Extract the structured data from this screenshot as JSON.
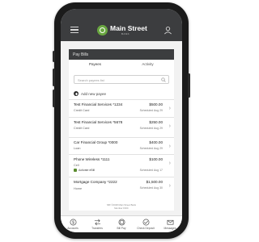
{
  "app": {
    "brand_name": "Main Street",
    "brand_sub": "BANK"
  },
  "header": {
    "title": "Pay Bills"
  },
  "tabs": [
    {
      "label": "Payees",
      "active": true
    },
    {
      "label": "Activity",
      "active": false
    }
  ],
  "search": {
    "placeholder": "Search payees list"
  },
  "add_payee": {
    "label": "Add new payee"
  },
  "payees": [
    {
      "name": "Test Financial Services *1234",
      "type": "Credit Card",
      "amount": "$500.00",
      "scheduled": "Scheduled Aug 29"
    },
    {
      "name": "Test Financial Services *5678",
      "type": "Credit Card",
      "amount": "$250.00",
      "scheduled": "Scheduled Aug 29"
    },
    {
      "name": "Car Financial Group *0000",
      "type": "Loan",
      "amount": "$400.00",
      "scheduled": "Scheduled Aug 29"
    },
    {
      "name": "Phone Wireless *1111",
      "type": "Cell",
      "activate": "Activate eBill",
      "amount": "$100.00",
      "scheduled": "Scheduled Aug 17"
    },
    {
      "name": "Mortgage Company *2222",
      "type": "Home",
      "amount": "$1,500.00",
      "scheduled": "Scheduled Aug 30"
    }
  ],
  "footer": {
    "line1": "NB! ©2018 Main Street Bank",
    "line2": "Member FDIC"
  },
  "bottom_nav": [
    {
      "label": "Accounts",
      "icon": "dollar-circle-icon"
    },
    {
      "label": "Transfers",
      "icon": "transfer-arrows-icon"
    },
    {
      "label": "Bill Pay",
      "icon": "bill-pay-icon"
    },
    {
      "label": "Check Deposit",
      "icon": "camera-check-icon"
    },
    {
      "label": "Messages",
      "icon": "envelope-icon"
    }
  ],
  "colors": {
    "appbar": "#3c3d3f",
    "accent": "#69a640",
    "tab_active": "#4b6e9e"
  }
}
